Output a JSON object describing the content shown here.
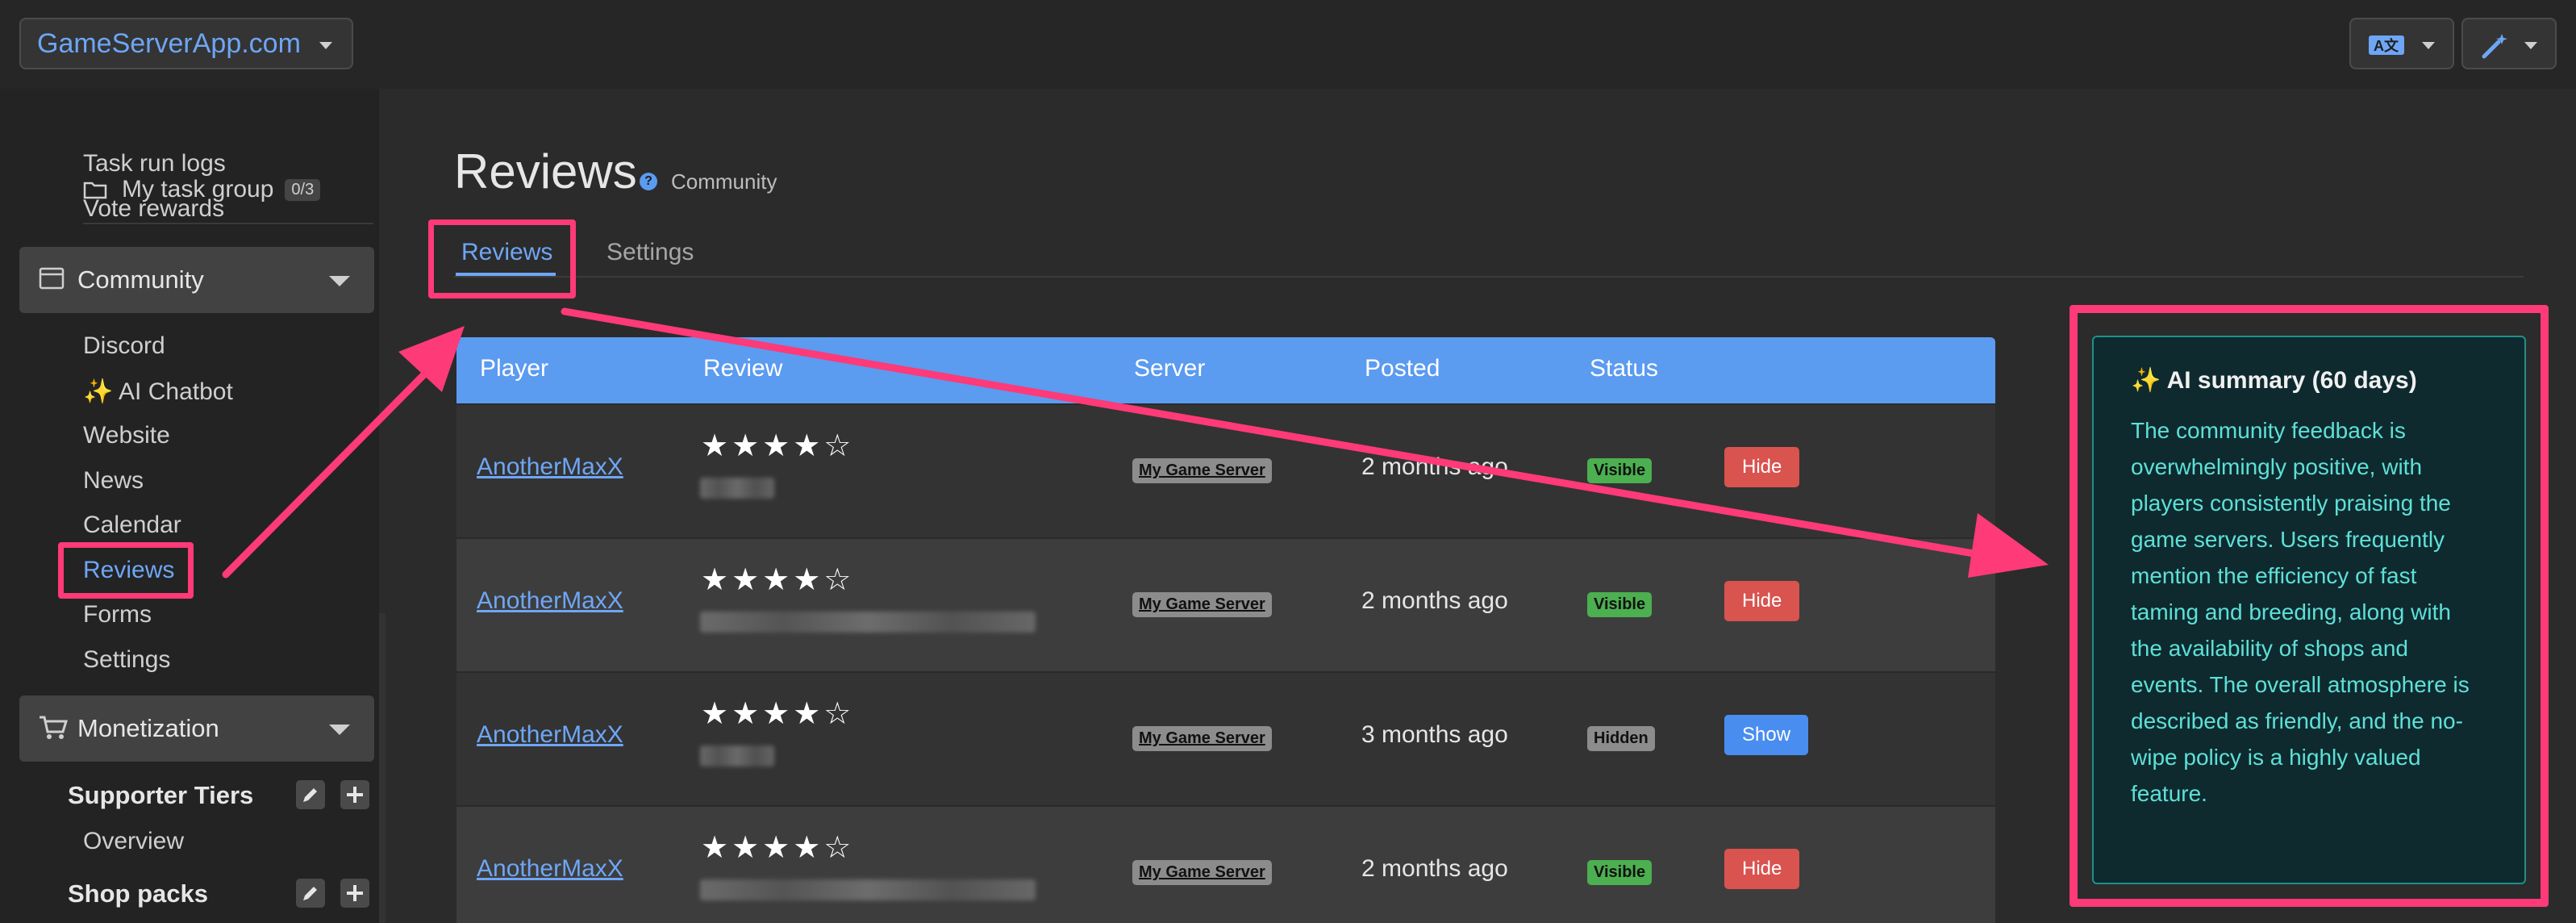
{
  "topbar": {
    "site_name": "GameServerApp.com"
  },
  "sidebar": {
    "folder_item": "My task group",
    "folder_badge": "0/3",
    "links_top": [
      "Task run logs",
      "Vote rewards"
    ],
    "community_section": "Community",
    "community_items": [
      "Discord",
      "✨ AI Chatbot",
      "Website",
      "News",
      "Calendar",
      "Reviews",
      "Forms",
      "Settings"
    ],
    "monetization_section": "Monetization",
    "supporter_tiers": "Supporter Tiers",
    "overview": "Overview",
    "shop_packs": "Shop packs"
  },
  "page": {
    "title": "Reviews",
    "tag": "Community",
    "tabs": [
      "Reviews",
      "Settings"
    ]
  },
  "table": {
    "headers": [
      "Player",
      "Review",
      "Server",
      "Posted",
      "Status"
    ],
    "rows": [
      {
        "player": "AnotherMaxX",
        "stars": "★★★★☆",
        "server": "My Game Server",
        "posted": "2 months ago",
        "status": "Visible",
        "action": "Hide"
      },
      {
        "player": "AnotherMaxX",
        "stars": "★★★★☆",
        "server": "My Game Server",
        "posted": "2 months ago",
        "status": "Visible",
        "action": "Hide"
      },
      {
        "player": "AnotherMaxX",
        "stars": "★★★★☆",
        "server": "My Game Server",
        "posted": "3 months ago",
        "status": "Hidden",
        "action": "Show"
      },
      {
        "player": "AnotherMaxX",
        "stars": "★★★★☆",
        "server": "My Game Server",
        "posted": "2 months ago",
        "status": "Visible",
        "action": "Hide"
      }
    ]
  },
  "ai_summary": {
    "title": "✨ AI summary (60 days)",
    "body": "The community feedback is overwhelmingly positive, with players consistently praising the game servers. Users frequently mention the efficiency of fast taming and breeding, along with the availability of shops and events. The overall atmosphere is described as friendly, and the no-wipe policy is a highly valued feature."
  },
  "colors": {
    "accent": "#5b9bf0",
    "highlight": "#ff3a78",
    "ai_text": "#5ee0d7"
  }
}
